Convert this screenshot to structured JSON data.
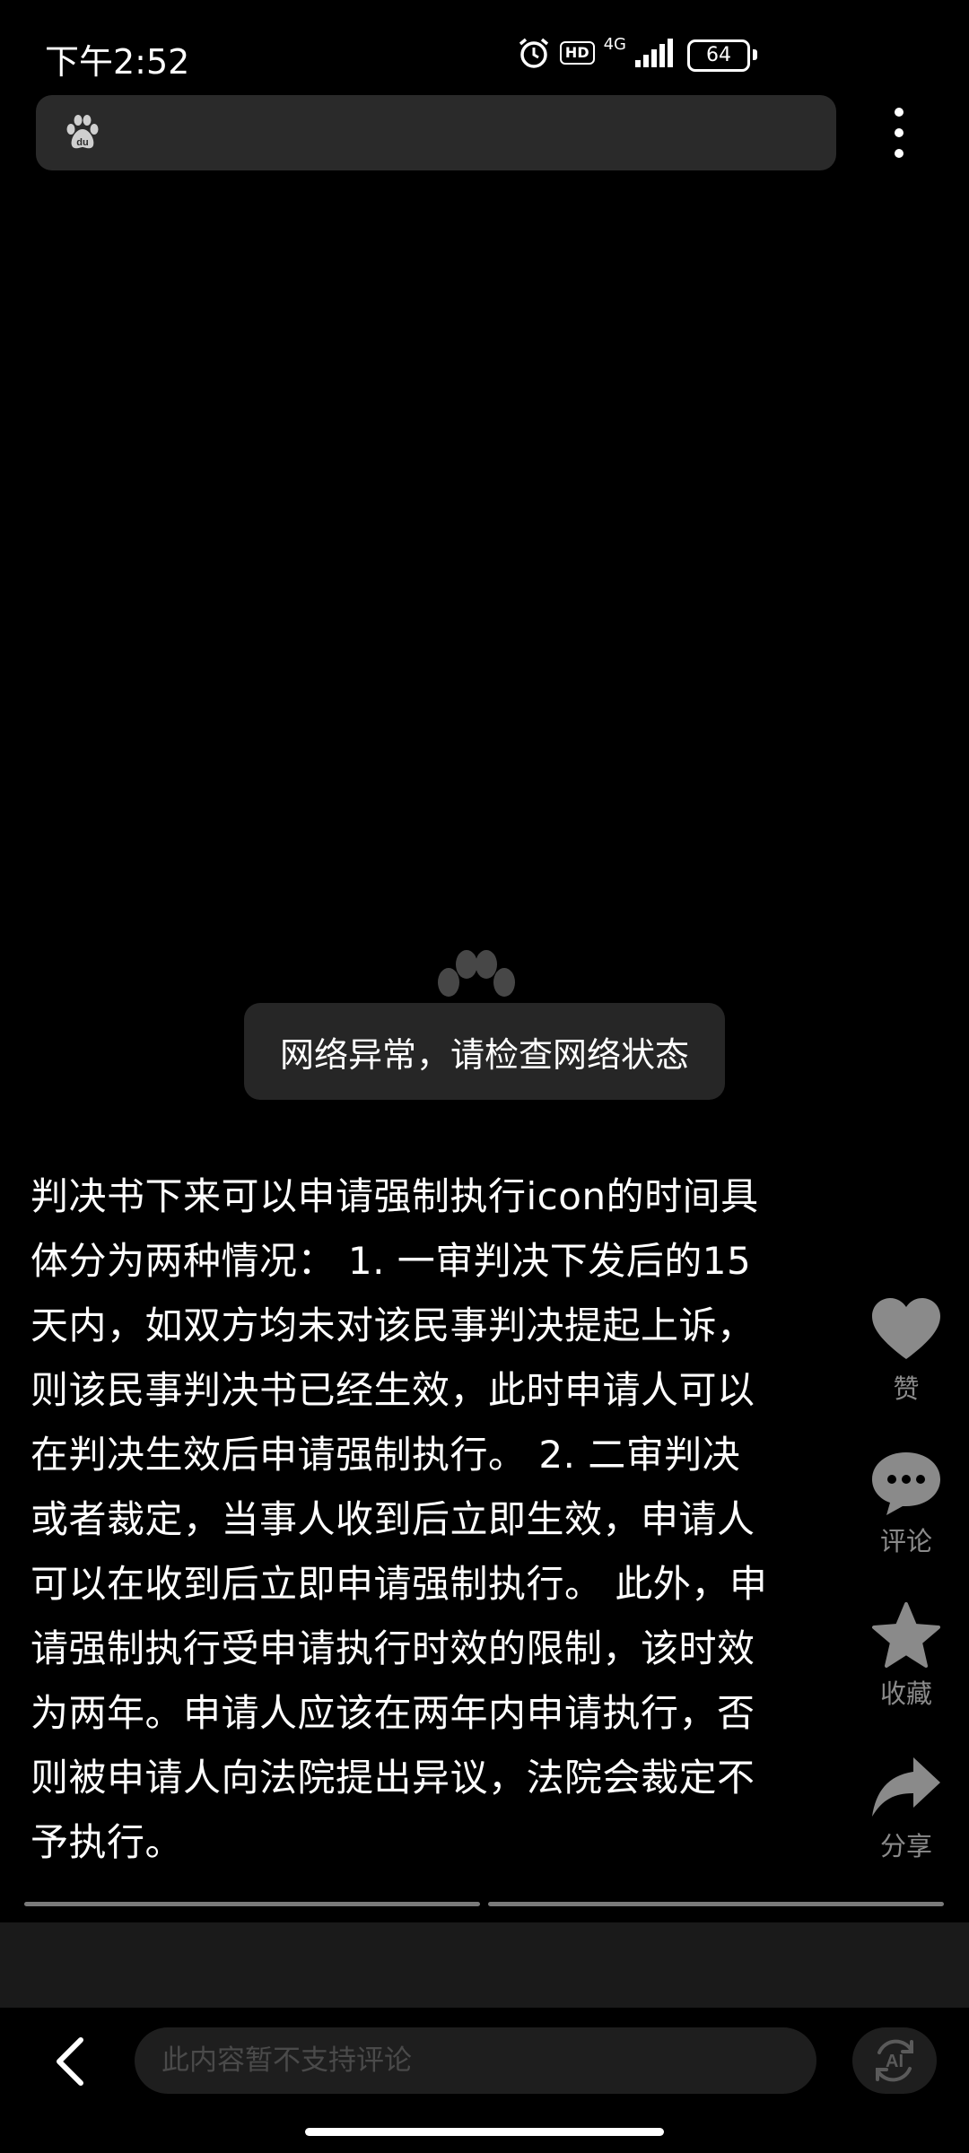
{
  "status_bar": {
    "time": "下午2:52",
    "hd": "HD",
    "network": "4G",
    "battery": "64"
  },
  "toast": {
    "message": "网络异常，请检查网络状态"
  },
  "article": {
    "text": "判决书下来可以申请强制执行icon的时间具体分为两种情况： 1. 一审判决下发后的15天内，如双方均未对该民事判决提起上诉，则该民事判决书已经生效，此时申请人可以在判决生效后申请强制执行。 2. 二审判决或者裁定，当事人收到后立即生效，申请人可以在收到后立即申请强制执行。 此外，申请强制执行受申请执行时效的限制，该时效为两年。申请人应该在两年内申请执行，否则被申请人向法院提出异议，法院会裁定不予执行。"
  },
  "actions": {
    "like_label": "赞",
    "comment_label": "评论",
    "favorite_label": "收藏",
    "share_label": "分享"
  },
  "bottom_bar": {
    "comment_placeholder": "此内容暂不支持评论",
    "ai_label": "AI"
  },
  "colors": {
    "background": "#000000",
    "action_gray": "#8a8a8a",
    "toast_bg": "#262626"
  }
}
